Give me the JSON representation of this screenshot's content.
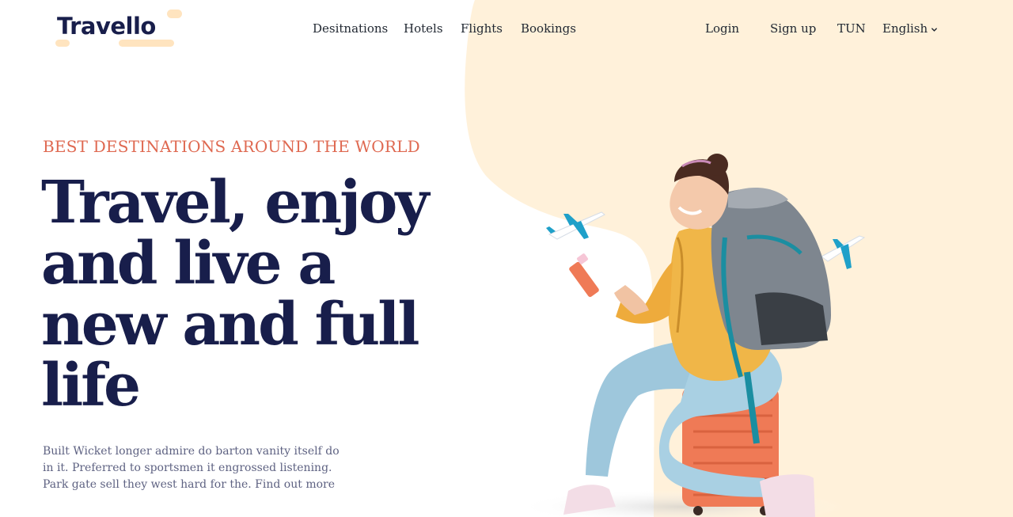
{
  "brand": {
    "name": "Travello"
  },
  "nav": {
    "links": [
      "Desitnations",
      "Hotels",
      "Flights",
      "Bookings"
    ],
    "login": "Login",
    "signup": "Sign up",
    "currency": "TUN",
    "language": "English"
  },
  "hero": {
    "eyebrow": "BEST DESTINATIONS AROUND THE WORLD",
    "headline_lines": [
      "Travel, enjoy",
      "and live a",
      "new and full",
      "life"
    ],
    "description": "Built Wicket longer admire do barton vanity itself do in it. Preferred to sportsmen it engrossed listening. Park gate sell they west hard for the. Find out more"
  },
  "colors": {
    "primary": "#181e4b",
    "accent": "#df6951",
    "blob": "#fff1da",
    "body_text": "#5e6282"
  },
  "icons": [
    "chevron-down-icon",
    "airplane-icon"
  ]
}
